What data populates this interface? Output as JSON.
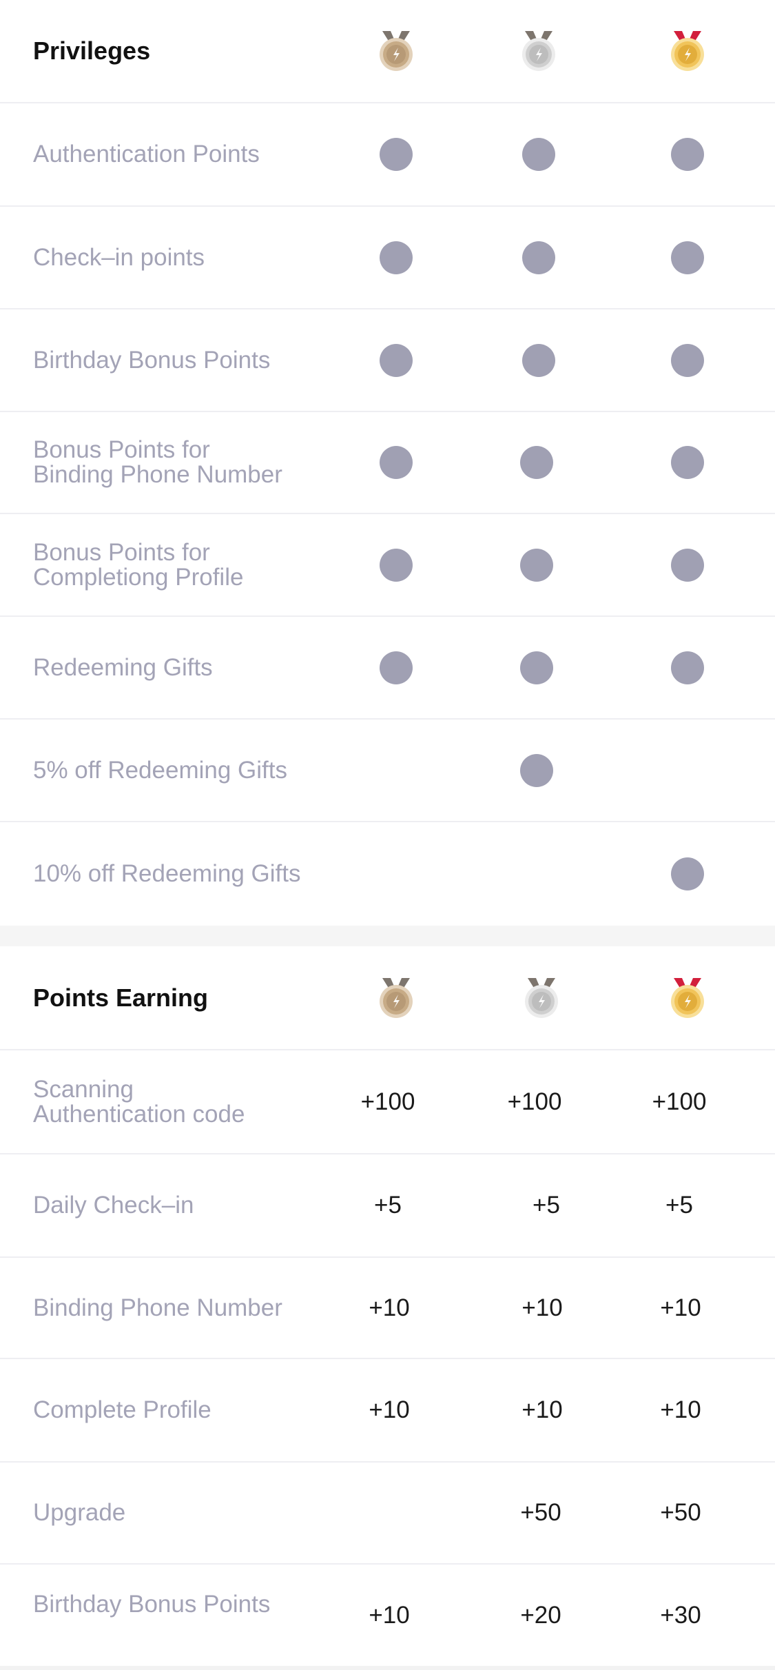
{
  "colors": {
    "dot": "#a0a0b3",
    "label": "#a3a3b6",
    "title": "#111111",
    "bronze": "#c7ab86",
    "silver": "#cfcfcf",
    "gold": "#f1c45a",
    "gold_ribbon": "#d21f3c",
    "ribbon_dark": "#7d756d"
  },
  "privileges": {
    "title": "Privileges",
    "tiers": [
      "bronze-medal-icon",
      "silver-medal-icon",
      "gold-medal-icon"
    ],
    "rows": [
      {
        "label": "Authentication Points",
        "tiers": [
          true,
          true,
          true
        ]
      },
      {
        "label": "Check–in points",
        "tiers": [
          true,
          true,
          true
        ]
      },
      {
        "label": "Birthday Bonus Points",
        "tiers": [
          true,
          true,
          true
        ]
      },
      {
        "label": "Bonus Points for\nBinding Phone Number",
        "tiers": [
          true,
          true,
          true
        ]
      },
      {
        "label": "Bonus Points for\nCompletiong Profile",
        "tiers": [
          true,
          true,
          true
        ]
      },
      {
        "label": "Redeeming Gifts",
        "tiers": [
          true,
          true,
          true
        ]
      },
      {
        "label": "5% off Redeeming Gifts",
        "tiers": [
          false,
          true,
          false
        ]
      },
      {
        "label": "10% off Redeeming Gifts",
        "tiers": [
          false,
          false,
          true
        ]
      }
    ]
  },
  "earning": {
    "title": "Points Earning",
    "tiers": [
      "bronze-medal-icon",
      "silver-medal-icon",
      "gold-medal-icon"
    ],
    "rows": [
      {
        "label": "Scanning\nAuthentication code",
        "values": [
          "+100",
          "+100",
          "+100"
        ]
      },
      {
        "label": "Daily Check–in",
        "values": [
          "+5",
          "+5",
          "+5"
        ]
      },
      {
        "label": "Binding Phone Number",
        "values": [
          "+10",
          "+10",
          "+10"
        ]
      },
      {
        "label": "Complete Profile",
        "values": [
          "+10",
          "+10",
          "+10"
        ]
      },
      {
        "label": "Upgrade",
        "values": [
          "",
          "+50",
          "+50"
        ]
      },
      {
        "label": "Birthday Bonus Points",
        "values": [
          "+10",
          "+20",
          "+30"
        ]
      }
    ]
  }
}
